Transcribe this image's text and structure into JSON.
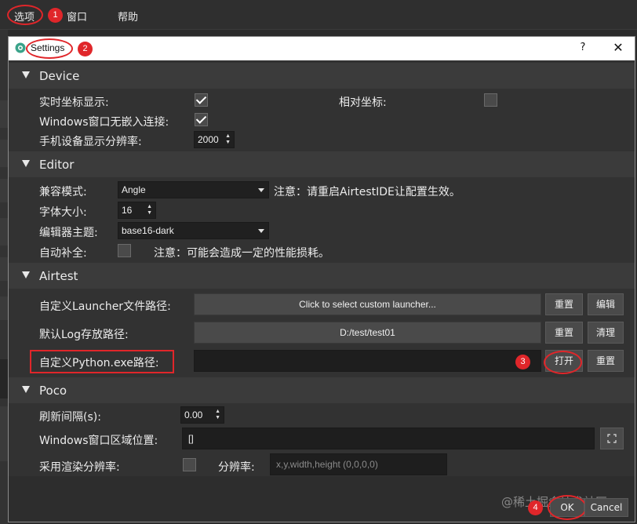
{
  "menubar": {
    "options_label": "选项",
    "window_label": "窗口",
    "help_label": "帮助"
  },
  "badges": {
    "b1": "1",
    "b2": "2",
    "b3": "3",
    "b4": "4"
  },
  "dialog": {
    "title": "Settings",
    "help_glyph": "?",
    "close_glyph": "✕"
  },
  "device": {
    "header": "Device",
    "realtime_coord_label": "实时坐标显示:",
    "realtime_coord_checked": true,
    "relative_coord_label": "相对坐标:",
    "relative_coord_checked": false,
    "windows_embed_label": "Windows窗口无嵌入连接:",
    "windows_embed_checked": true,
    "resolution_label": "手机设备显示分辨率:",
    "resolution_value": "2000"
  },
  "editor": {
    "header": "Editor",
    "compat_label": "兼容模式:",
    "compat_value": "Angle",
    "compat_note": "注意：请重启AirtestIDE让配置生效。",
    "font_size_label": "字体大小:",
    "font_size_value": "16",
    "theme_label": "编辑器主题:",
    "theme_value": "base16-dark",
    "autocomplete_label": "自动补全:",
    "autocomplete_checked": false,
    "autocomplete_note": "注意：可能会造成一定的性能损耗。"
  },
  "airtest": {
    "header": "Airtest",
    "launcher_label": "自定义Launcher文件路径:",
    "launcher_value": "Click to select custom launcher...",
    "launcher_reset": "重置",
    "launcher_edit": "编辑",
    "log_label": "默认Log存放路径:",
    "log_value": "D:/test/test01",
    "log_reset": "重置",
    "log_clear": "清理",
    "python_label": "自定义Python.exe路径:",
    "python_value": "",
    "python_open": "打开",
    "python_reset": "重置"
  },
  "poco": {
    "header": "Poco",
    "refresh_label": "刷新间隔(s):",
    "refresh_value": "0.00",
    "window_region_label": "Windows窗口区域位置:",
    "window_region_value": "[]",
    "render_res_label": "采用渲染分辨率:",
    "render_res_checked": false,
    "resolution_label": "分辨率:",
    "resolution_placeholder": "x,y,width,height (0,0,0,0)"
  },
  "footer": {
    "ok_label": "OK",
    "cancel_label": "Cancel"
  },
  "watermark": "@稀土掘金技术社区",
  "colors": {
    "accent_red": "#e0262a",
    "bg": "#323232",
    "section": "#3b3b3b"
  }
}
